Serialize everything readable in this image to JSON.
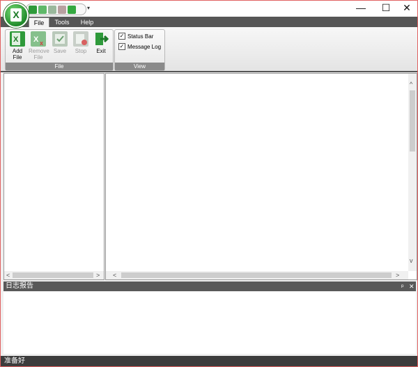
{
  "app": {
    "orb_glyph": "X",
    "quick_access_icons": [
      "excel-icon",
      "excel-remove-icon",
      "save-icon",
      "stop-icon",
      "exit-icon"
    ],
    "qat_dropdown": "▾"
  },
  "window_controls": {
    "minimize": "—",
    "maximize": "☐",
    "close": "✕"
  },
  "tabs": [
    {
      "label": "File",
      "active": true
    },
    {
      "label": "Tools",
      "active": false
    },
    {
      "label": "Help",
      "active": false
    }
  ],
  "ribbon": {
    "file_group": {
      "label": "File",
      "buttons": [
        {
          "line1": "Add",
          "line2": "File",
          "enabled": true
        },
        {
          "line1": "Remove",
          "line2": "File",
          "enabled": false
        },
        {
          "line1": "Save",
          "line2": "",
          "enabled": false
        },
        {
          "line1": "Stop",
          "line2": "",
          "enabled": false
        },
        {
          "line1": "Exit",
          "line2": "",
          "enabled": true
        }
      ]
    },
    "view_group": {
      "label": "View",
      "checkboxes": [
        {
          "label": "Status Bar",
          "checked": true
        },
        {
          "label": "Message Log",
          "checked": true
        }
      ]
    }
  },
  "scroll_arrows": {
    "left": "<",
    "right": ">",
    "up": "^",
    "down": "v"
  },
  "log_panel": {
    "title": "日志报告",
    "pin": "ᵖ",
    "close": "✕"
  },
  "status_bar": {
    "text": "准备好"
  },
  "colors": {
    "accent_green": "#1f8a2a",
    "ribbon_dark": "#565656",
    "window_border": "#e06060"
  }
}
